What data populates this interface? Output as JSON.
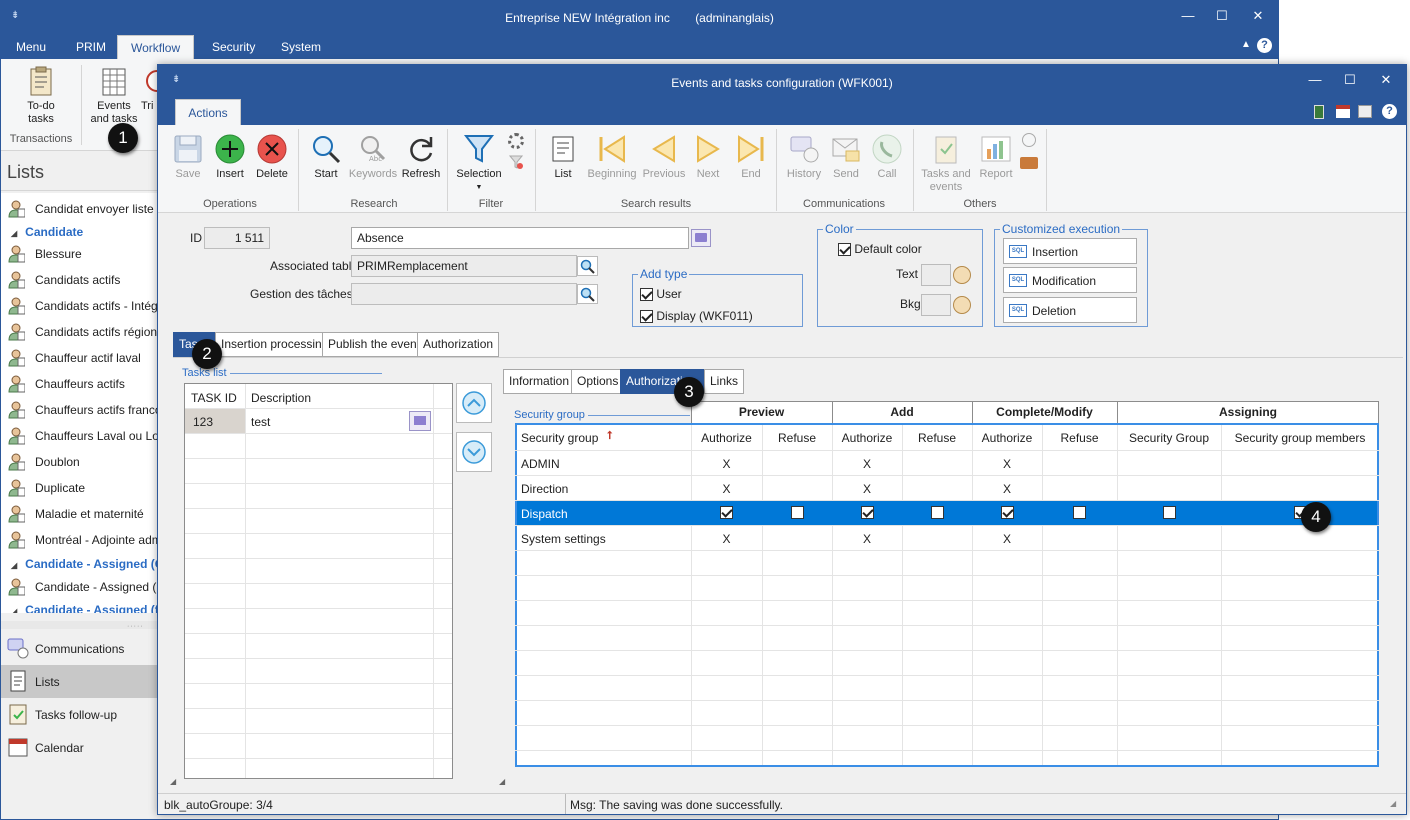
{
  "main_window": {
    "title": "Entreprise NEW Intégration inc",
    "user": "(adminanglais)",
    "menu_tabs": [
      "Menu",
      "PRIM",
      "Workflow",
      "Security",
      "System"
    ],
    "active_menu_tab": "Workflow",
    "ribbon": {
      "todo_label": "To-do tasks",
      "events_label": "Events and tasks",
      "clipped_label": "Tri",
      "group_label": "Transactions"
    }
  },
  "left_panel": {
    "title": "Lists",
    "items": [
      {
        "kind": "item",
        "label": "Candidat envoyer liste c"
      },
      {
        "kind": "group",
        "label": "Candidate"
      },
      {
        "kind": "item",
        "label": "Blessure"
      },
      {
        "kind": "item",
        "label": "Candidats actifs"
      },
      {
        "kind": "item",
        "label": "Candidats actifs - Intég"
      },
      {
        "kind": "item",
        "label": "Candidats actifs région"
      },
      {
        "kind": "item",
        "label": "Chauffeur actif laval"
      },
      {
        "kind": "item",
        "label": "Chauffeurs actifs"
      },
      {
        "kind": "item",
        "label": "Chauffeurs actifs franco"
      },
      {
        "kind": "item",
        "label": "Chauffeurs Laval ou Lon"
      },
      {
        "kind": "item",
        "label": "Doublon"
      },
      {
        "kind": "item",
        "label": "Duplicate"
      },
      {
        "kind": "item",
        "label": "Maladie et maternité"
      },
      {
        "kind": "item",
        "label": "Montréal - Adjointe adm"
      },
      {
        "kind": "group",
        "label": "Candidate - Assigned (Cu"
      },
      {
        "kind": "item",
        "label": "Candidate - Assigned (C"
      },
      {
        "kind": "group",
        "label": "Candidate - Assigned (fo"
      }
    ],
    "nav": [
      {
        "label": "Communications",
        "icon": "chat-icon"
      },
      {
        "label": "Lists",
        "icon": "list-icon",
        "active": true
      },
      {
        "label": "Tasks follow-up",
        "icon": "clipboard-icon"
      },
      {
        "label": "Calendar",
        "icon": "calendar-icon"
      }
    ]
  },
  "dialog": {
    "title": "Events and tasks configuration (WFK001)",
    "actions_tab": "Actions",
    "ribbon": {
      "save": "Save",
      "insert": "Insert",
      "delete": "Delete",
      "operations": "Operations",
      "start": "Start",
      "keywords": "Keywords",
      "refresh": "Refresh",
      "research": "Research",
      "selection": "Selection",
      "filter": "Filter",
      "list": "List",
      "beginning": "Beginning",
      "previous": "Previous",
      "next": "Next",
      "end": "End",
      "search_results": "Search results",
      "history": "History",
      "send": "Send",
      "call": "Call",
      "communications": "Communications",
      "tasks_events": "Tasks and events",
      "report": "Report",
      "others": "Others"
    },
    "form": {
      "id_label": "ID",
      "id_value": "1 511",
      "name_value": "Absence",
      "assoc_label": "Associated table",
      "assoc_value": "PRIMRemplacement",
      "gestion_label": "Gestion des tâches",
      "gestion_value": "",
      "add_type": {
        "legend": "Add type",
        "user": "User",
        "display": "Display (WKF011)"
      },
      "color": {
        "legend": "Color",
        "default": "Default color",
        "text": "Text",
        "bkg": "Bkg"
      },
      "custom_exec": {
        "legend": "Customized execution",
        "insertion": "Insertion",
        "modification": "Modification",
        "deletion": "Deletion"
      }
    },
    "tabs": [
      "Task",
      "Insertion processing",
      "Publish the event",
      "Authorization"
    ],
    "task_tab_visible": "Tas",
    "tasks_list": {
      "legend": "Tasks list",
      "col_id": "TASK ID",
      "col_desc": "Description",
      "rows": [
        {
          "id": "123",
          "desc": "test"
        }
      ]
    },
    "sub_tabs": [
      "Information",
      "Options",
      "Authorization",
      "Links"
    ],
    "sub_tab_authorization_visible": "Authorizatio",
    "security_group_legend": "Security group",
    "auth_grid": {
      "groups": [
        "Preview",
        "Add",
        "Complete/Modify",
        "Assigning"
      ],
      "columns": [
        "Security group",
        "Authorize",
        "Refuse",
        "Authorize",
        "Refuse",
        "Authorize",
        "Refuse",
        "Security Group",
        "Security group members"
      ],
      "rows": [
        {
          "name": "ADMIN",
          "cells": [
            "X",
            "",
            "X",
            "",
            "X",
            "",
            "",
            ""
          ],
          "selected": false
        },
        {
          "name": "Direction",
          "cells": [
            "X",
            "",
            "X",
            "",
            "X",
            "",
            "",
            ""
          ],
          "selected": false
        },
        {
          "name": "Dispatch",
          "cells": [
            "on",
            "off",
            "on",
            "off",
            "on",
            "off",
            "off",
            "on"
          ],
          "selected": true
        },
        {
          "name": "System settings",
          "cells": [
            "X",
            "",
            "X",
            "",
            "X",
            "",
            "",
            ""
          ],
          "selected": false
        }
      ]
    },
    "status": {
      "left": "blk_autoGroupe: 3/4",
      "msg": "Msg: The saving was done successfully."
    }
  },
  "badges": [
    "1",
    "2",
    "3",
    "4"
  ],
  "colors": {
    "title_bar": "#2b579a",
    "selection": "#0078d7",
    "accent_text": "#2b6cc4"
  }
}
